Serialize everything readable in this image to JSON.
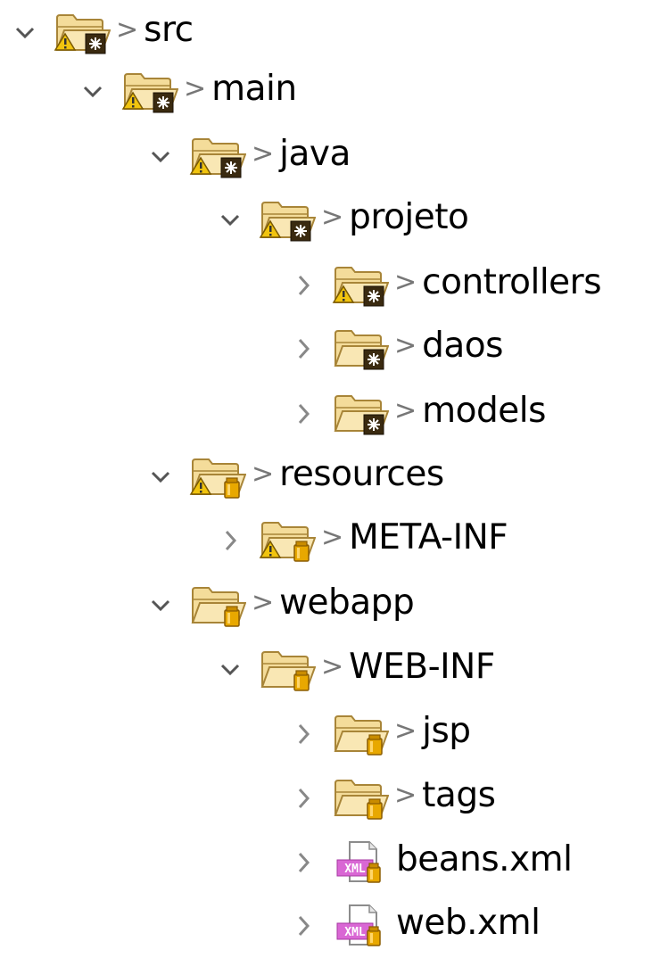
{
  "tree": {
    "nodes": [
      {
        "label": "src",
        "expanded": true,
        "icon": "source-folder-warning-icon",
        "decoration": ">"
      },
      {
        "label": "main",
        "expanded": true,
        "icon": "source-folder-warning-icon",
        "decoration": ">"
      },
      {
        "label": "java",
        "expanded": true,
        "icon": "source-folder-warning-icon",
        "decoration": ">"
      },
      {
        "label": "projeto",
        "expanded": true,
        "icon": "source-folder-warning-icon",
        "decoration": ">"
      },
      {
        "label": "controllers",
        "expanded": false,
        "icon": "source-folder-warning-icon",
        "decoration": ">"
      },
      {
        "label": "daos",
        "expanded": false,
        "icon": "source-folder-icon",
        "decoration": ">"
      },
      {
        "label": "models",
        "expanded": false,
        "icon": "source-folder-icon",
        "decoration": ">"
      },
      {
        "label": "resources",
        "expanded": true,
        "icon": "resource-folder-warning-icon",
        "decoration": ">"
      },
      {
        "label": "META-INF",
        "expanded": false,
        "icon": "resource-folder-warning-icon",
        "decoration": ">"
      },
      {
        "label": "webapp",
        "expanded": true,
        "icon": "resource-folder-icon",
        "decoration": ">"
      },
      {
        "label": "WEB-INF",
        "expanded": true,
        "icon": "resource-folder-icon",
        "decoration": ">"
      },
      {
        "label": "jsp",
        "expanded": false,
        "icon": "resource-folder-icon",
        "decoration": ">"
      },
      {
        "label": "tags",
        "expanded": false,
        "icon": "resource-folder-icon",
        "decoration": ">"
      },
      {
        "label": "beans.xml",
        "expanded": false,
        "icon": "xml-file-icon",
        "decoration": ""
      },
      {
        "label": "web.xml",
        "expanded": false,
        "icon": "xml-file-icon",
        "decoration": ""
      }
    ]
  },
  "colors": {
    "folder_fill": "#f4dc9a",
    "folder_outline": "#a88538",
    "warning": "#f1c40f",
    "source_badge": "#3a2a10",
    "resource_jar": "#e8a800",
    "xml_badge": "#d967d4",
    "twisty": "#555555"
  }
}
